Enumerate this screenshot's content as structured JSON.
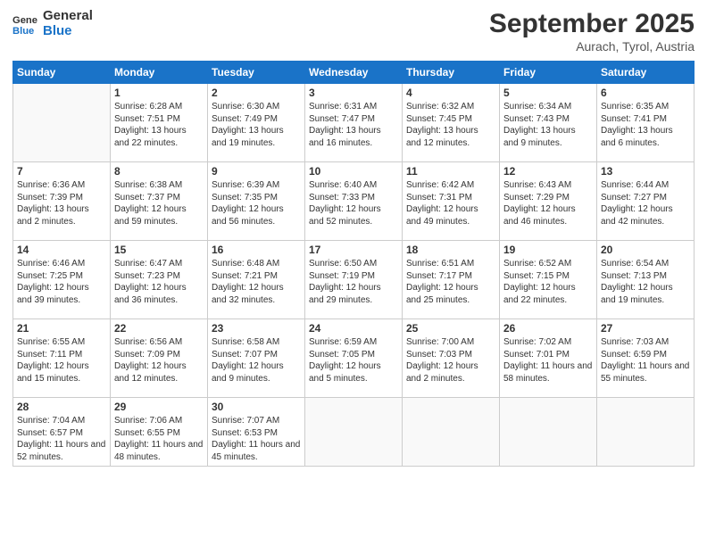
{
  "header": {
    "logo_line1": "General",
    "logo_line2": "Blue",
    "month": "September 2025",
    "location": "Aurach, Tyrol, Austria"
  },
  "weekdays": [
    "Sunday",
    "Monday",
    "Tuesday",
    "Wednesday",
    "Thursday",
    "Friday",
    "Saturday"
  ],
  "weeks": [
    [
      {
        "day": "",
        "sunrise": "",
        "sunset": "",
        "daylight": ""
      },
      {
        "day": "1",
        "sunrise": "Sunrise: 6:28 AM",
        "sunset": "Sunset: 7:51 PM",
        "daylight": "Daylight: 13 hours and 22 minutes."
      },
      {
        "day": "2",
        "sunrise": "Sunrise: 6:30 AM",
        "sunset": "Sunset: 7:49 PM",
        "daylight": "Daylight: 13 hours and 19 minutes."
      },
      {
        "day": "3",
        "sunrise": "Sunrise: 6:31 AM",
        "sunset": "Sunset: 7:47 PM",
        "daylight": "Daylight: 13 hours and 16 minutes."
      },
      {
        "day": "4",
        "sunrise": "Sunrise: 6:32 AM",
        "sunset": "Sunset: 7:45 PM",
        "daylight": "Daylight: 13 hours and 12 minutes."
      },
      {
        "day": "5",
        "sunrise": "Sunrise: 6:34 AM",
        "sunset": "Sunset: 7:43 PM",
        "daylight": "Daylight: 13 hours and 9 minutes."
      },
      {
        "day": "6",
        "sunrise": "Sunrise: 6:35 AM",
        "sunset": "Sunset: 7:41 PM",
        "daylight": "Daylight: 13 hours and 6 minutes."
      }
    ],
    [
      {
        "day": "7",
        "sunrise": "Sunrise: 6:36 AM",
        "sunset": "Sunset: 7:39 PM",
        "daylight": "Daylight: 13 hours and 2 minutes."
      },
      {
        "day": "8",
        "sunrise": "Sunrise: 6:38 AM",
        "sunset": "Sunset: 7:37 PM",
        "daylight": "Daylight: 12 hours and 59 minutes."
      },
      {
        "day": "9",
        "sunrise": "Sunrise: 6:39 AM",
        "sunset": "Sunset: 7:35 PM",
        "daylight": "Daylight: 12 hours and 56 minutes."
      },
      {
        "day": "10",
        "sunrise": "Sunrise: 6:40 AM",
        "sunset": "Sunset: 7:33 PM",
        "daylight": "Daylight: 12 hours and 52 minutes."
      },
      {
        "day": "11",
        "sunrise": "Sunrise: 6:42 AM",
        "sunset": "Sunset: 7:31 PM",
        "daylight": "Daylight: 12 hours and 49 minutes."
      },
      {
        "day": "12",
        "sunrise": "Sunrise: 6:43 AM",
        "sunset": "Sunset: 7:29 PM",
        "daylight": "Daylight: 12 hours and 46 minutes."
      },
      {
        "day": "13",
        "sunrise": "Sunrise: 6:44 AM",
        "sunset": "Sunset: 7:27 PM",
        "daylight": "Daylight: 12 hours and 42 minutes."
      }
    ],
    [
      {
        "day": "14",
        "sunrise": "Sunrise: 6:46 AM",
        "sunset": "Sunset: 7:25 PM",
        "daylight": "Daylight: 12 hours and 39 minutes."
      },
      {
        "day": "15",
        "sunrise": "Sunrise: 6:47 AM",
        "sunset": "Sunset: 7:23 PM",
        "daylight": "Daylight: 12 hours and 36 minutes."
      },
      {
        "day": "16",
        "sunrise": "Sunrise: 6:48 AM",
        "sunset": "Sunset: 7:21 PM",
        "daylight": "Daylight: 12 hours and 32 minutes."
      },
      {
        "day": "17",
        "sunrise": "Sunrise: 6:50 AM",
        "sunset": "Sunset: 7:19 PM",
        "daylight": "Daylight: 12 hours and 29 minutes."
      },
      {
        "day": "18",
        "sunrise": "Sunrise: 6:51 AM",
        "sunset": "Sunset: 7:17 PM",
        "daylight": "Daylight: 12 hours and 25 minutes."
      },
      {
        "day": "19",
        "sunrise": "Sunrise: 6:52 AM",
        "sunset": "Sunset: 7:15 PM",
        "daylight": "Daylight: 12 hours and 22 minutes."
      },
      {
        "day": "20",
        "sunrise": "Sunrise: 6:54 AM",
        "sunset": "Sunset: 7:13 PM",
        "daylight": "Daylight: 12 hours and 19 minutes."
      }
    ],
    [
      {
        "day": "21",
        "sunrise": "Sunrise: 6:55 AM",
        "sunset": "Sunset: 7:11 PM",
        "daylight": "Daylight: 12 hours and 15 minutes."
      },
      {
        "day": "22",
        "sunrise": "Sunrise: 6:56 AM",
        "sunset": "Sunset: 7:09 PM",
        "daylight": "Daylight: 12 hours and 12 minutes."
      },
      {
        "day": "23",
        "sunrise": "Sunrise: 6:58 AM",
        "sunset": "Sunset: 7:07 PM",
        "daylight": "Daylight: 12 hours and 9 minutes."
      },
      {
        "day": "24",
        "sunrise": "Sunrise: 6:59 AM",
        "sunset": "Sunset: 7:05 PM",
        "daylight": "Daylight: 12 hours and 5 minutes."
      },
      {
        "day": "25",
        "sunrise": "Sunrise: 7:00 AM",
        "sunset": "Sunset: 7:03 PM",
        "daylight": "Daylight: 12 hours and 2 minutes."
      },
      {
        "day": "26",
        "sunrise": "Sunrise: 7:02 AM",
        "sunset": "Sunset: 7:01 PM",
        "daylight": "Daylight: 11 hours and 58 minutes."
      },
      {
        "day": "27",
        "sunrise": "Sunrise: 7:03 AM",
        "sunset": "Sunset: 6:59 PM",
        "daylight": "Daylight: 11 hours and 55 minutes."
      }
    ],
    [
      {
        "day": "28",
        "sunrise": "Sunrise: 7:04 AM",
        "sunset": "Sunset: 6:57 PM",
        "daylight": "Daylight: 11 hours and 52 minutes."
      },
      {
        "day": "29",
        "sunrise": "Sunrise: 7:06 AM",
        "sunset": "Sunset: 6:55 PM",
        "daylight": "Daylight: 11 hours and 48 minutes."
      },
      {
        "day": "30",
        "sunrise": "Sunrise: 7:07 AM",
        "sunset": "Sunset: 6:53 PM",
        "daylight": "Daylight: 11 hours and 45 minutes."
      },
      {
        "day": "",
        "sunrise": "",
        "sunset": "",
        "daylight": ""
      },
      {
        "day": "",
        "sunrise": "",
        "sunset": "",
        "daylight": ""
      },
      {
        "day": "",
        "sunrise": "",
        "sunset": "",
        "daylight": ""
      },
      {
        "day": "",
        "sunrise": "",
        "sunset": "",
        "daylight": ""
      }
    ]
  ]
}
